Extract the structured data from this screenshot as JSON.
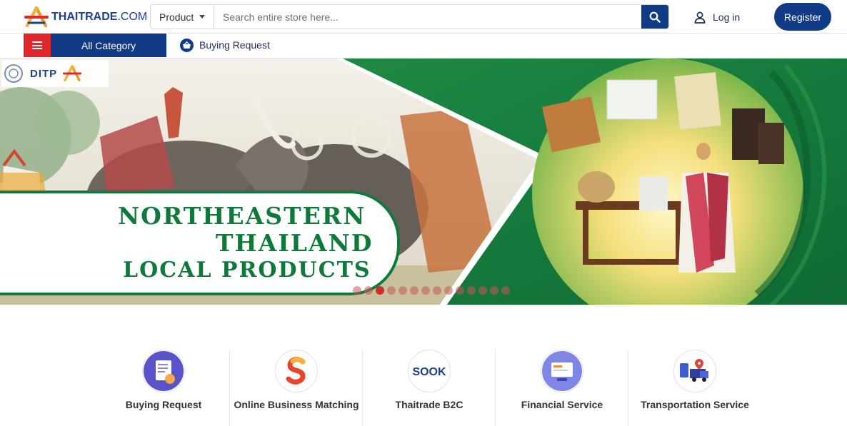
{
  "brand": {
    "name_bold": "THAITRADE",
    "name_light": ".COM"
  },
  "search": {
    "category": "Product",
    "placeholder": "Search entire store here..."
  },
  "header": {
    "login_label": "Log in",
    "register_label": "Register"
  },
  "nav": {
    "all_category": "All Category",
    "buying_request": "Buying Request"
  },
  "hero": {
    "agency_logo_text": "DITP",
    "mini_brand": "THAITRADE.COM",
    "title_lines": [
      "NORTHEASTERN",
      "THAILAND",
      "LOCAL PRODUCTS"
    ],
    "slide_count": 14,
    "active_slide": 3,
    "accent_green": "#0d7a3a"
  },
  "services": [
    {
      "label": "Buying Request",
      "icon": "buying-request-icon"
    },
    {
      "label": "Online Business Matching",
      "icon": "online-business-matching-icon"
    },
    {
      "label": "Thaitrade B2C",
      "icon": "sook-logo-icon",
      "icon_text": "SOOK"
    },
    {
      "label": "Financial Service",
      "icon": "financial-service-icon"
    },
    {
      "label": "Transportation Service",
      "icon": "transportation-service-icon"
    }
  ],
  "colors": {
    "primary_navy": "#123b87",
    "menu_red": "#e0252b"
  }
}
